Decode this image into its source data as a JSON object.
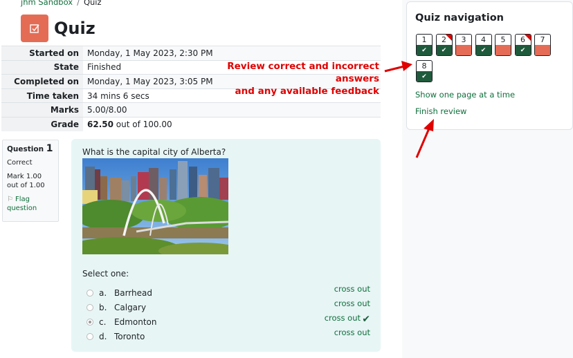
{
  "breadcrumb": [
    {
      "label": "jhm Sandbox",
      "link": true
    },
    {
      "label": "Quiz",
      "link": false
    }
  ],
  "breadcrumb_separator": "/",
  "page": {
    "title": "Quiz",
    "icon": "quiz-checkbox-icon",
    "accent_color": "#e46c55"
  },
  "summary": [
    {
      "label": "Started on",
      "value": "Monday, 1 May 2023, 2:30 PM"
    },
    {
      "label": "State",
      "value": "Finished"
    },
    {
      "label": "Completed on",
      "value": "Monday, 1 May 2023, 3:05 PM"
    },
    {
      "label": "Time taken",
      "value": "34 mins 6 secs"
    },
    {
      "label": "Marks",
      "value": "5.00/8.00"
    },
    {
      "label": "Grade",
      "value_bold": "62.50",
      "value_rest": " out of 100.00"
    }
  ],
  "annotation": {
    "line1": "Review correct and incorrect answers",
    "line2": "and any available feedback",
    "color": "#e00000"
  },
  "question_info": {
    "label": "Question",
    "number": "1",
    "state": "Correct",
    "grade": "Mark 1.00 out of 1.00",
    "flag_label": "Flag question"
  },
  "question": {
    "text": "What is the capital city of Alberta?",
    "image_alt": "Edmonton skyline with Walterdale Bridge",
    "prompt": "Select one:",
    "answers": [
      {
        "letter": "a.",
        "label": "Barrhead",
        "checked": false,
        "crossout": "cross out",
        "correct": false
      },
      {
        "letter": "b.",
        "label": "Calgary",
        "checked": false,
        "crossout": "cross out",
        "correct": false
      },
      {
        "letter": "c.",
        "label": "Edmonton",
        "checked": true,
        "crossout": "cross out",
        "correct": true
      },
      {
        "letter": "d.",
        "label": "Toronto",
        "checked": false,
        "crossout": "cross out",
        "correct": false
      }
    ]
  },
  "quiz_navigation": {
    "title": "Quiz navigation",
    "questions": [
      {
        "num": "1",
        "status": "correct",
        "flagged": false
      },
      {
        "num": "2",
        "status": "correct",
        "flagged": true
      },
      {
        "num": "3",
        "status": "incorrect",
        "flagged": false
      },
      {
        "num": "4",
        "status": "correct",
        "flagged": false
      },
      {
        "num": "5",
        "status": "incorrect",
        "flagged": false
      },
      {
        "num": "6",
        "status": "correct",
        "flagged": true
      },
      {
        "num": "7",
        "status": "incorrect",
        "flagged": false
      },
      {
        "num": "8",
        "status": "correct",
        "flagged": false
      }
    ],
    "show_one_page": "Show one page at a time",
    "finish_review": "Finish review",
    "colors": {
      "correct": "#1f5a3c",
      "incorrect": "#e56c57",
      "flag": "#e00000",
      "link": "#0f6e3b"
    }
  }
}
